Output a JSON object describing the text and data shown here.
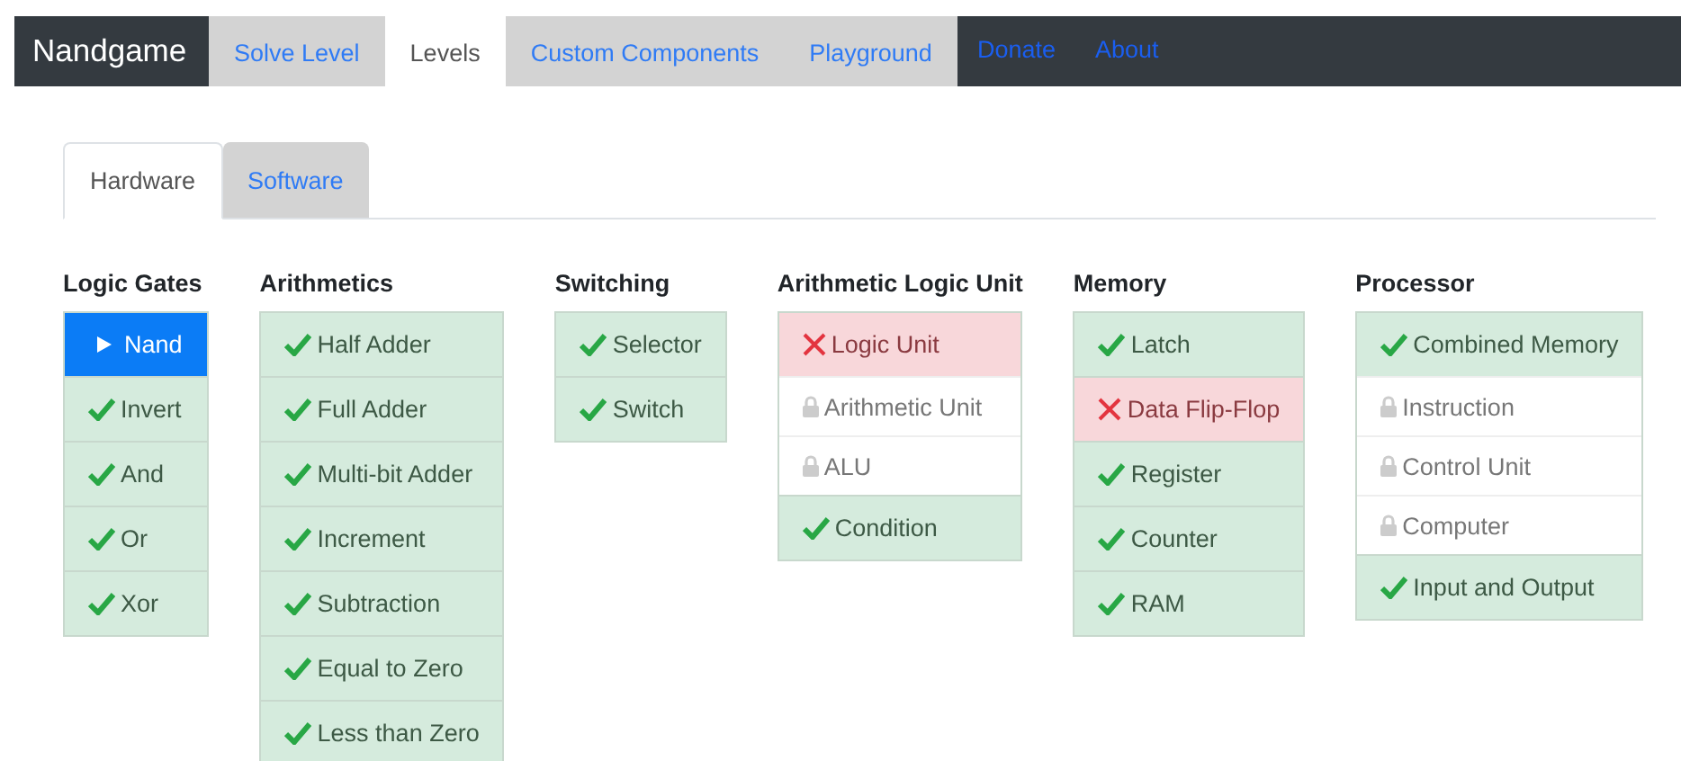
{
  "navbar": {
    "brand": "Nandgame",
    "items": [
      {
        "label": "Solve Level",
        "kind": "tab",
        "selected": false
      },
      {
        "label": "Levels",
        "kind": "tab",
        "selected": true
      },
      {
        "label": "Custom Components",
        "kind": "tab",
        "selected": false
      },
      {
        "label": "Playground",
        "kind": "tab",
        "selected": false
      },
      {
        "label": "Donate",
        "kind": "link",
        "selected": false
      },
      {
        "label": "About",
        "kind": "link",
        "selected": false
      }
    ]
  },
  "tabs": [
    {
      "label": "Hardware",
      "selected": true
    },
    {
      "label": "Software",
      "selected": false
    }
  ],
  "groups": [
    {
      "title": "Logic Gates",
      "levels": [
        {
          "label": "Nand",
          "kind": "current"
        },
        {
          "label": "Invert",
          "kind": "solved"
        },
        {
          "label": "And",
          "kind": "solved"
        },
        {
          "label": "Or",
          "kind": "solved"
        },
        {
          "label": "Xor",
          "kind": "solved"
        }
      ]
    },
    {
      "title": "Arithmetics",
      "levels": [
        {
          "label": "Half Adder",
          "kind": "solved"
        },
        {
          "label": "Full Adder",
          "kind": "solved"
        },
        {
          "label": "Multi-bit Adder",
          "kind": "solved"
        },
        {
          "label": "Increment",
          "kind": "solved"
        },
        {
          "label": "Subtraction",
          "kind": "solved"
        },
        {
          "label": "Equal to Zero",
          "kind": "solved"
        },
        {
          "label": "Less than Zero",
          "kind": "solved"
        }
      ]
    },
    {
      "title": "Switching",
      "levels": [
        {
          "label": "Selector",
          "kind": "solved"
        },
        {
          "label": "Switch",
          "kind": "solved"
        }
      ]
    },
    {
      "title": "Arithmetic Logic Unit",
      "levels": [
        {
          "label": "Logic Unit",
          "kind": "failed"
        },
        {
          "label": "Arithmetic Unit",
          "kind": "locked"
        },
        {
          "label": "ALU",
          "kind": "locked"
        },
        {
          "label": "Condition",
          "kind": "solved"
        }
      ]
    },
    {
      "title": "Memory",
      "levels": [
        {
          "label": "Latch",
          "kind": "solved"
        },
        {
          "label": "Data Flip-Flop",
          "kind": "failed"
        },
        {
          "label": "Register",
          "kind": "solved"
        },
        {
          "label": "Counter",
          "kind": "solved"
        },
        {
          "label": "RAM",
          "kind": "solved"
        }
      ]
    },
    {
      "title": "Processor",
      "levels": [
        {
          "label": "Combined Memory",
          "kind": "solved"
        },
        {
          "label": "Instruction",
          "kind": "locked"
        },
        {
          "label": "Control Unit",
          "kind": "locked"
        },
        {
          "label": "Computer",
          "kind": "locked"
        },
        {
          "label": "Input and Output",
          "kind": "solved"
        }
      ]
    }
  ]
}
